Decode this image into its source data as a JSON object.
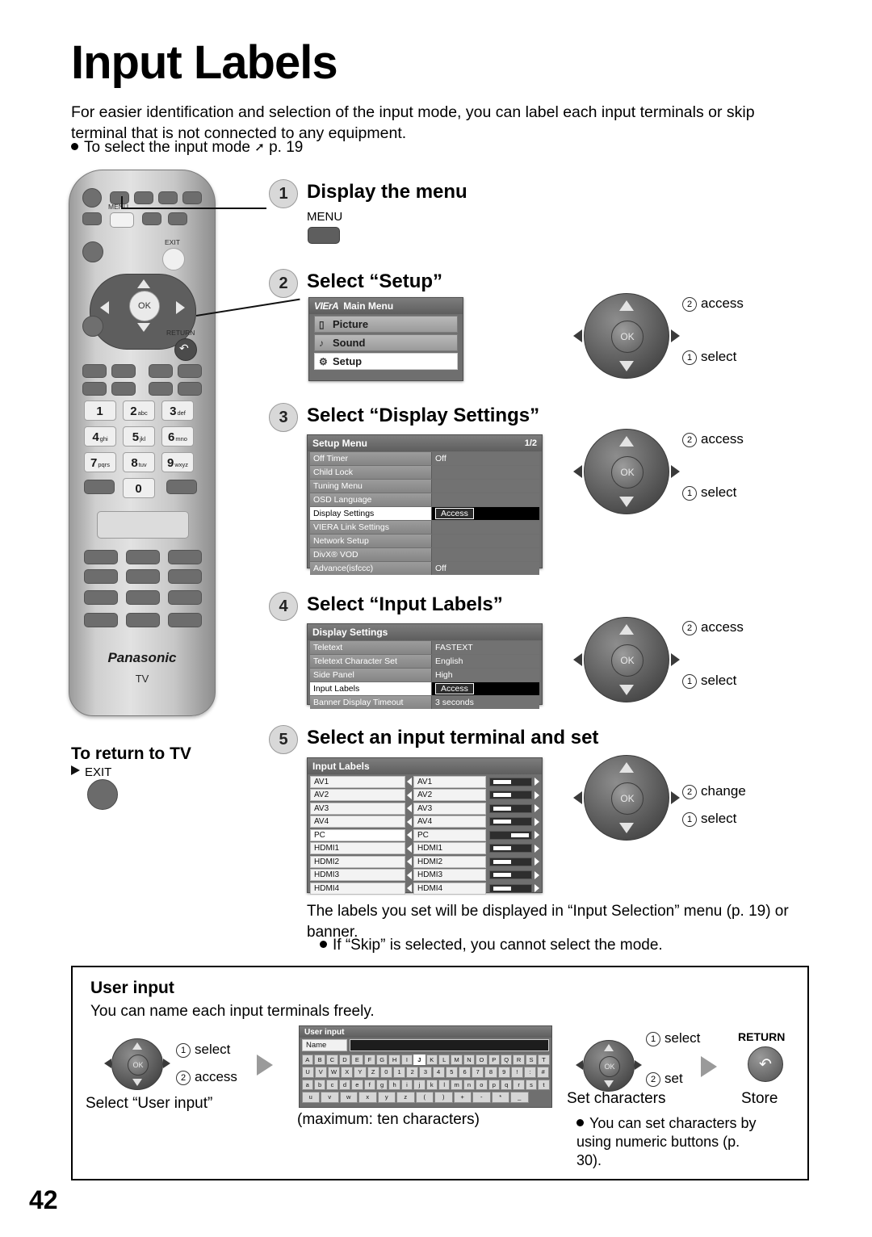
{
  "page": {
    "title": "Input Labels",
    "intro": "For easier identification and selection of the input mode, you can label each input terminals or skip terminal that is not connected to any equipment.",
    "bullet": "To select the input mode",
    "bullet_ref": "p. 19",
    "page_number": "42"
  },
  "remote": {
    "menu_label": "MENU",
    "exit_label": "EXIT",
    "return_label": "RETURN",
    "ok_label": "OK",
    "brand": "Panasonic",
    "brand_sub": "TV",
    "keys": [
      {
        "num": "1",
        "sub": ""
      },
      {
        "num": "2",
        "sub": "abc"
      },
      {
        "num": "3",
        "sub": "def"
      },
      {
        "num": "4",
        "sub": "ghi"
      },
      {
        "num": "5",
        "sub": "jkl"
      },
      {
        "num": "6",
        "sub": "mno"
      },
      {
        "num": "7",
        "sub": "pqrs"
      },
      {
        "num": "8",
        "sub": "tuv"
      },
      {
        "num": "9",
        "sub": "wxyz"
      },
      {
        "num": "0",
        "sub": ""
      }
    ]
  },
  "steps": [
    {
      "num": "1",
      "title": "Display the menu"
    },
    {
      "num": "2",
      "title": "Select “Setup”"
    },
    {
      "num": "3",
      "title": "Select “Display Settings”"
    },
    {
      "num": "4",
      "title": "Select “Input Labels”"
    },
    {
      "num": "5",
      "title": "Select an input terminal and set"
    }
  ],
  "step1": {
    "key_label": "MENU"
  },
  "main_menu": {
    "brand": "VIErA",
    "title": "Main Menu",
    "items": [
      {
        "label": "Picture",
        "selected": false
      },
      {
        "label": "Sound",
        "selected": false
      },
      {
        "label": "Setup",
        "selected": true
      }
    ]
  },
  "setup_menu": {
    "title": "Setup Menu",
    "page": "1/2",
    "rows": [
      {
        "label": "Off Timer",
        "value": "Off",
        "selected": false
      },
      {
        "label": "Child Lock",
        "value": "",
        "selected": false
      },
      {
        "label": "Tuning Menu",
        "value": "",
        "selected": false
      },
      {
        "label": "OSD Language",
        "value": "",
        "selected": false
      },
      {
        "label": "Display Settings",
        "value": "Access",
        "selected": true
      },
      {
        "label": "VIERA Link Settings",
        "value": "",
        "selected": false
      },
      {
        "label": "Network Setup",
        "value": "",
        "selected": false
      },
      {
        "label": "DivX® VOD",
        "value": "",
        "selected": false
      },
      {
        "label": "Advance(isfccc)",
        "value": "Off",
        "selected": false
      }
    ]
  },
  "display_settings": {
    "title": "Display Settings",
    "rows": [
      {
        "label": "Teletext",
        "value": "FASTEXT",
        "selected": false
      },
      {
        "label": "Teletext Character Set",
        "value": "English",
        "selected": false
      },
      {
        "label": "Side Panel",
        "value": "High",
        "selected": false
      },
      {
        "label": "Input Labels",
        "value": "Access",
        "selected": true
      },
      {
        "label": "Banner Display Timeout",
        "value": "3 seconds",
        "selected": false
      }
    ]
  },
  "input_labels": {
    "title": "Input Labels",
    "rows": [
      {
        "name": "AV1",
        "value": "AV1",
        "selected": false
      },
      {
        "name": "AV2",
        "value": "AV2",
        "selected": false
      },
      {
        "name": "AV3",
        "value": "AV3",
        "selected": false
      },
      {
        "name": "AV4",
        "value": "AV4",
        "selected": false
      },
      {
        "name": "PC",
        "value": "PC",
        "selected": true
      },
      {
        "name": "HDMI1",
        "value": "HDMI1",
        "selected": false
      },
      {
        "name": "HDMI2",
        "value": "HDMI2",
        "selected": false
      },
      {
        "name": "HDMI3",
        "value": "HDMI3",
        "selected": false
      },
      {
        "name": "HDMI4",
        "value": "HDMI4",
        "selected": false
      }
    ]
  },
  "pads": {
    "ok": "OK",
    "step2": {
      "a": "access",
      "b": "select",
      "a_num": "②",
      "b_num": "①"
    },
    "step3": {
      "a": "access",
      "b": "select",
      "a_num": "②",
      "b_num": "①"
    },
    "step4": {
      "a": "access",
      "b": "select",
      "a_num": "②",
      "b_num": "①"
    },
    "step5": {
      "a": "change",
      "b": "select",
      "a_num": "②",
      "b_num": "①"
    }
  },
  "return_to_tv": {
    "title": "To return to TV",
    "key": "EXIT"
  },
  "after_note": {
    "line1": "The labels you set will be displayed in “Input Selection” menu (p. 19) or banner.",
    "bullet": "If “Skip” is selected, you cannot select the mode."
  },
  "user_input": {
    "title": "User input",
    "subtitle": "You can name each input terminals freely.",
    "pad_select": "select",
    "pad_access": "access",
    "pad_select_num": "①",
    "pad_access_num": "②",
    "caption_left": "Select “User input”",
    "osd_title": "User input",
    "name_label": "Name",
    "caption_center": "(maximum: ten characters)",
    "pad2_select": "select",
    "pad2_set": "set",
    "pad2_select_num": "①",
    "pad2_set_num": "②",
    "caption_set": "Set characters",
    "bullet": "You can set characters by using numeric buttons (p. 30).",
    "return_label": "RETURN",
    "store_label": "Store",
    "keyboard": [
      [
        "A",
        "B",
        "C",
        "D",
        "E",
        "F",
        "G",
        "H",
        "I",
        "J",
        "K",
        "L",
        "M",
        "N",
        "O",
        "P",
        "Q",
        "R",
        "S",
        "T"
      ],
      [
        "U",
        "V",
        "W",
        "X",
        "Y",
        "Z",
        "0",
        "1",
        "2",
        "3",
        "4",
        "5",
        "6",
        "7",
        "8",
        "9",
        "!",
        ":",
        "#"
      ],
      [
        "a",
        "b",
        "c",
        "d",
        "e",
        "f",
        "g",
        "h",
        "i",
        "j",
        "k",
        "l",
        "m",
        "n",
        "o",
        "p",
        "q",
        "r",
        "s",
        "t"
      ],
      [
        "u",
        "v",
        "w",
        "x",
        "y",
        "z",
        "(",
        ")",
        "+",
        "-",
        "*",
        "_"
      ]
    ],
    "selected_key": "J"
  }
}
